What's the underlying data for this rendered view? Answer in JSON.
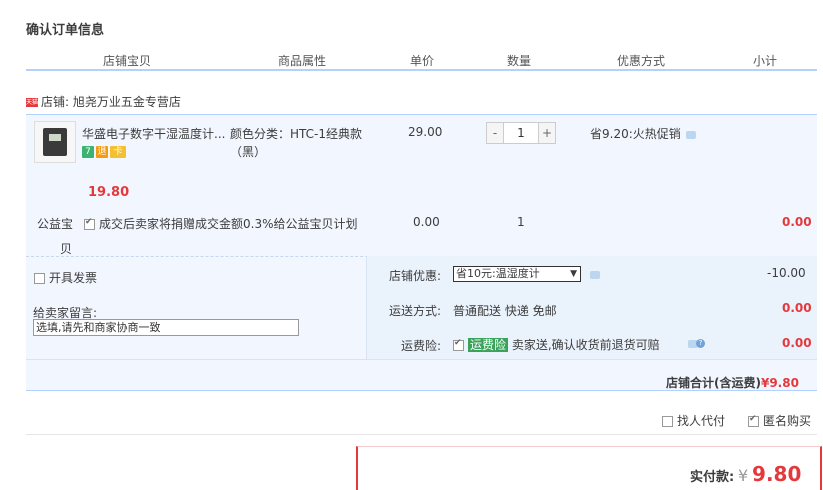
{
  "page_title": "确认订单信息",
  "columns": [
    "店铺宝贝",
    "商品属性",
    "单价",
    "数量",
    "优惠方式",
    "小计"
  ],
  "shop": {
    "badge": "天猫",
    "label": "店铺: 旭尧万业五金专营店"
  },
  "item": {
    "name": "华盛电子数字干湿温度计...",
    "attr_line1": "颜色分类：HTC-1经典款",
    "attr_line2": "（黑）",
    "unit_price": "29.00",
    "quantity": "1",
    "qty_minus": "-",
    "qty_plus": "+",
    "discount": "省9.20:火热促销",
    "subtotal": "19.80",
    "badge_icons": [
      "7",
      "退",
      "卡"
    ]
  },
  "charity": {
    "label_line1": "公益宝",
    "label_line2": "贝",
    "text": "成交后卖家将捐赠成交金额0.3%给公益宝贝计划",
    "price": "0.00",
    "quantity": "1",
    "subtotal": "0.00"
  },
  "invoice": {
    "label": "开具发票"
  },
  "message": {
    "label": "给卖家留言:",
    "placeholder": "选填,请先和商家协商一致"
  },
  "shop_coupon": {
    "label": "店铺优惠:",
    "selected": "省10元:温湿度计",
    "amount": "-10.00"
  },
  "shipping": {
    "label": "运送方式:",
    "value": "普通配送 快递 免邮",
    "amount": "0.00"
  },
  "insurance": {
    "label": "运费险:",
    "badge": "运费险",
    "text": "卖家送,确认收货前退货可赔",
    "amount": "0.00"
  },
  "shop_total": {
    "label": "店铺合计(含运费)",
    "value": "¥9.80"
  },
  "options": {
    "proxy_pay": "找人代付",
    "anonymous": "匿名购买"
  },
  "payment": {
    "label": "实付款:",
    "currency": "¥",
    "value": "9.80"
  },
  "colors": {
    "accent_red": "#e4393c",
    "header_line": "#b2d1ff",
    "panel_bg": "#f2f7ff"
  }
}
